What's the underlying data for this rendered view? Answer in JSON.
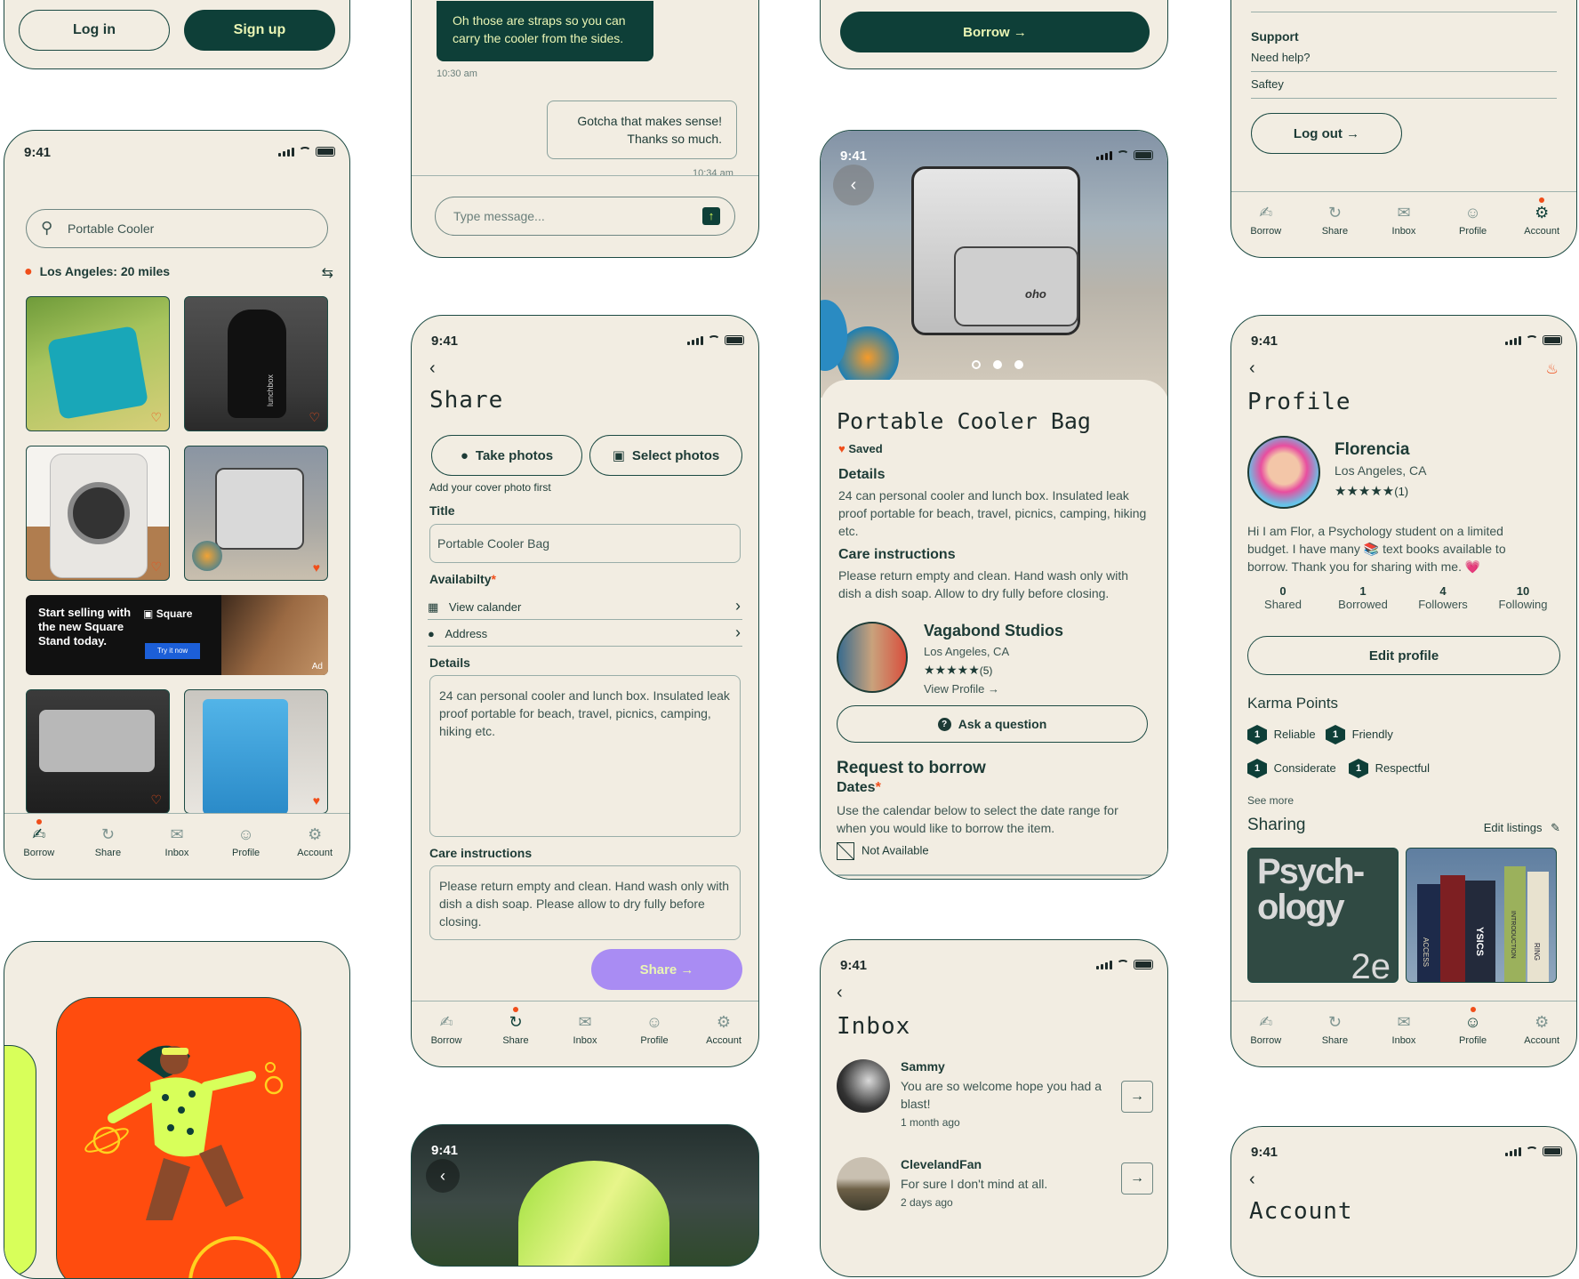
{
  "status_time": "9:41",
  "tabs": [
    {
      "label": "Borrow",
      "icon": "hand-icon"
    },
    {
      "label": "Share",
      "icon": "refresh-icon"
    },
    {
      "label": "Inbox",
      "icon": "mail-icon"
    },
    {
      "label": "Profile",
      "icon": "person-icon"
    },
    {
      "label": "Account",
      "icon": "gear-icon"
    }
  ],
  "auth": {
    "login": "Log in",
    "signup": "Sign up"
  },
  "browse": {
    "search_value": "Portable Cooler",
    "location": "Los Angeles: 20 miles",
    "ad": {
      "text": "Start selling with the new Square Stand today.",
      "brand": "Square",
      "cta": "Try it now",
      "tag": "Ad"
    },
    "thumb_brand": "lunchbox"
  },
  "chat": {
    "incoming": "Oh those are straps so you can carry the cooler from the sides.",
    "incoming_time": "10:30 am",
    "outgoing": "Gotcha that makes sense! Thanks so much.",
    "outgoing_time": "10:34 am",
    "placeholder": "Type message..."
  },
  "share": {
    "title": "Share",
    "take_photos": "Take photos",
    "select_photos": "Select photos",
    "cover_hint": "Add your cover photo first",
    "title_label": "Title",
    "title_value": "Portable Cooler Bag",
    "availability_label": "Availabilty",
    "view_calendar": "View calander",
    "address": "Address",
    "details_label": "Details",
    "details_value": "24 can personal cooler and lunch box. Insulated leak proof portable for beach, travel, picnics, camping, hiking etc.",
    "care_label": "Care instructions",
    "care_value": "Please return empty and clean. Hand wash only with dish a dish soap. Please allow to dry fully before closing.",
    "submit": "Share →"
  },
  "detail": {
    "borrow_btn": "Borrow →",
    "product_title": "Portable Cooler Bag",
    "saved": "Saved",
    "details_label": "Details",
    "details_text": "24 can personal cooler and lunch box. Insulated leak proof portable for beach, travel, picnics, camping, hiking etc.",
    "care_label": "Care instructions",
    "care_text": "Please return empty and clean. Hand wash only with dish a dish soap. Allow to dry fully before closing.",
    "owner_name": "Vagabond Studios",
    "owner_location": "Los Angeles, CA",
    "owner_reviews": "(5)",
    "owner_rating": 5,
    "view_profile": "View Profile →",
    "ask": "Ask a question",
    "request_title": "Request to borrow",
    "dates_label": "Dates",
    "dates_hint": "Use the calendar below to select the date range for when you would like to borrow the item.",
    "not_available": "Not Available",
    "product_logo": "oho"
  },
  "inbox": {
    "title": "Inbox",
    "messages": [
      {
        "name": "Sammy",
        "text": "You are so welcome hope you had a blast!",
        "time": "1 month ago"
      },
      {
        "name": "ClevelandFan",
        "text": "For sure I don't mind at all.",
        "time": "2 days ago"
      }
    ]
  },
  "account_top": {
    "support_label": "Support",
    "need_help": "Need help?",
    "safety": "Saftey",
    "logout": "Log out →"
  },
  "profile": {
    "title": "Profile",
    "name": "Florencia",
    "location": "Los Angeles, CA",
    "reviews": "(1)",
    "rating": 5,
    "bio": "Hi I am Flor, a Psychology student on a limited budget. I have many 📚 text books available to borrow. Thank you for sharing with me. 💗",
    "stats": [
      {
        "value": "0",
        "label": "Shared"
      },
      {
        "value": "1",
        "label": "Borrowed"
      },
      {
        "value": "4",
        "label": "Followers"
      },
      {
        "value": "10",
        "label": "Following"
      }
    ],
    "edit_profile": "Edit profile",
    "karma_title": "Karma Points",
    "karma": [
      {
        "count": "1",
        "label": "Reliable"
      },
      {
        "count": "1",
        "label": "Friendly"
      },
      {
        "count": "1",
        "label": "Considerate"
      },
      {
        "count": "1",
        "label": "Respectful"
      }
    ],
    "see_more": "See more",
    "sharing_title": "Sharing",
    "edit_listings": "Edit listings",
    "book_text": "Psych-ology",
    "book_edition": "2e",
    "spines": [
      "ACCESS",
      "YSICS",
      "INTRODUCTION",
      "RING"
    ]
  },
  "account": {
    "title": "Account"
  },
  "colors": {
    "brand_dark": "#0e3f38",
    "accent_orange": "#f04e1a",
    "background": "#f2ede2",
    "accent_lime": "#eaf5b4",
    "accent_purple": "#a98cf3"
  }
}
